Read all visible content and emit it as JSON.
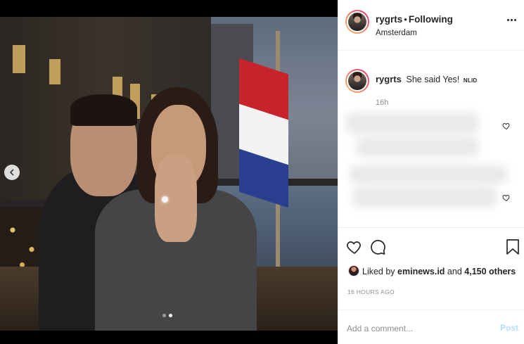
{
  "post": {
    "username": "rygrts",
    "bullet": "•",
    "follow_state": "Following",
    "location": "Amsterdam",
    "caption_text": "She said Yes!",
    "caption_tag": "NLID",
    "caption_time": "16h",
    "likes_prefix": "Liked by",
    "likes_user": "eminews.id",
    "likes_and": "and",
    "likes_count": "4,150 others",
    "time_ago": "16 HOURS AGO"
  },
  "comment": {
    "placeholder": "Add a comment...",
    "post_label": "Post"
  },
  "carousel": {
    "total_slides": 2,
    "active_slide": 2
  },
  "icons": {
    "prev": "chevron-left-icon",
    "more": "more-options-icon",
    "like": "heart-icon",
    "comment": "comment-icon",
    "save": "bookmark-icon"
  },
  "colors": {
    "accent_disabled": "#b3dbff",
    "text": "#262626",
    "muted": "#8e8e8e",
    "flag_red": "#c8232c",
    "flag_white": "#f2f2f2",
    "flag_blue": "#2a3f8f"
  }
}
